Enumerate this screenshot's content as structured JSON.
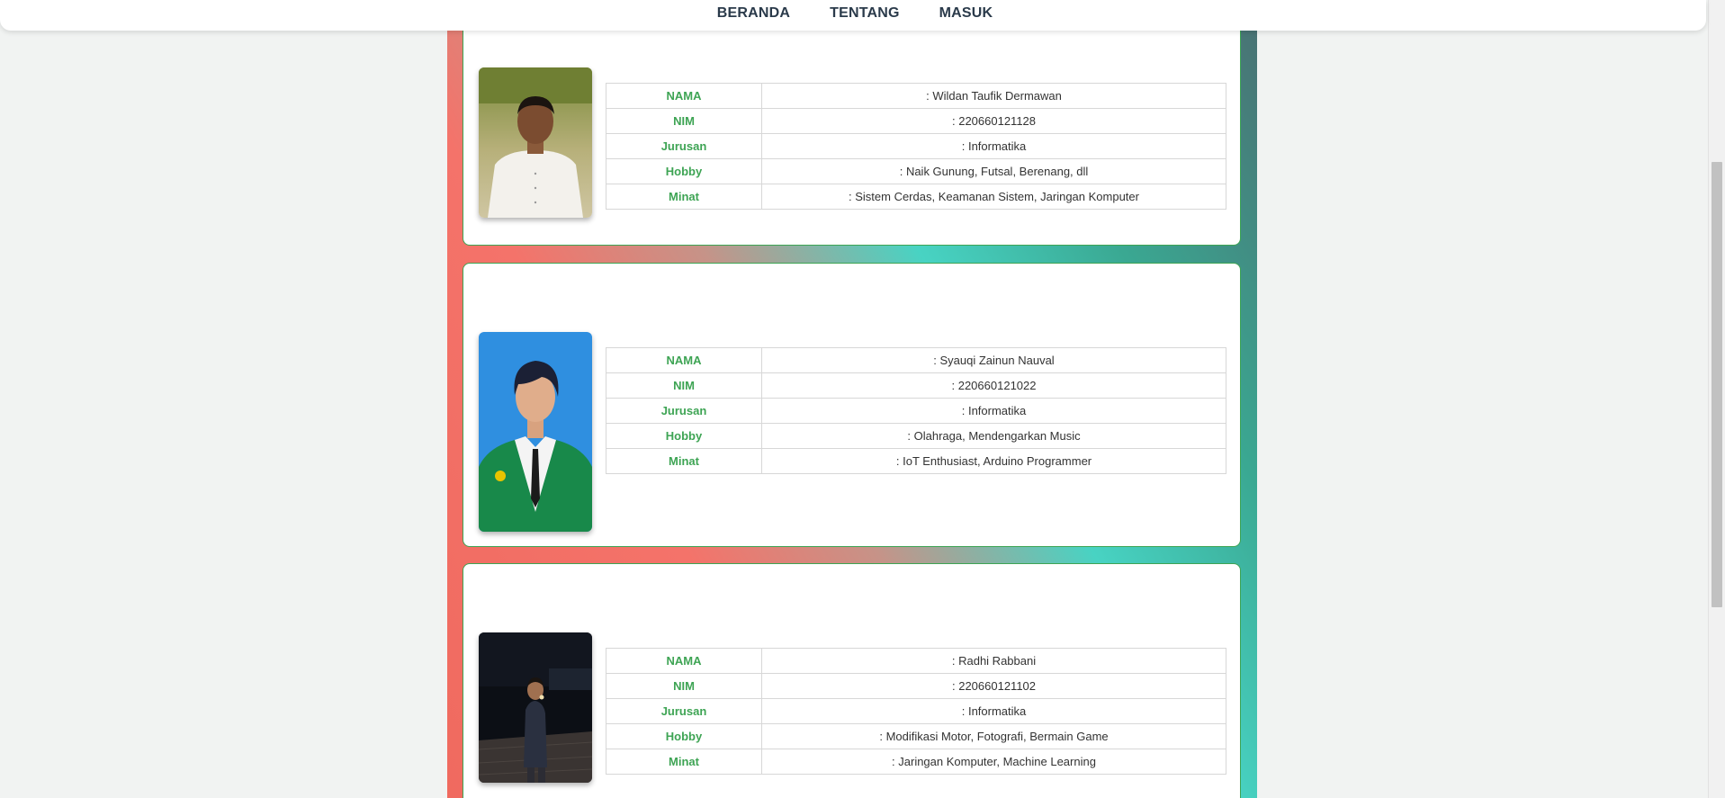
{
  "nav": {
    "items": [
      {
        "label": "BERANDA"
      },
      {
        "label": "TENTANG"
      },
      {
        "label": "MASUK"
      }
    ]
  },
  "labels": {
    "nama": "NAMA",
    "nim": "NIM",
    "jurusan": "Jurusan",
    "hobby": "Hobby",
    "minat": "Minat"
  },
  "profiles": [
    {
      "nama": ": Wildan Taufik Dermawan",
      "nim": ": 220660121128",
      "jurusan": ": Informatika",
      "hobby": ": Naik Gunung, Futsal, Berenang, dll",
      "minat": ": Sistem Cerdas, Keamanan Sistem, Jaringan Komputer"
    },
    {
      "nama": ": Syauqi Zainun Nauval",
      "nim": ": 220660121022",
      "jurusan": ": Informatika",
      "hobby": ": Olahraga, Mendengarkan Music",
      "minat": ": IoT Enthusiast, Arduino Programmer"
    },
    {
      "nama": ": Radhi Rabbani",
      "nim": ": 220660121102",
      "jurusan": ": Informatika",
      "hobby": ": Modifikasi Motor, Fotografi, Bermain Game",
      "minat": ": Jaringan Komputer, Machine Learning"
    }
  ]
}
